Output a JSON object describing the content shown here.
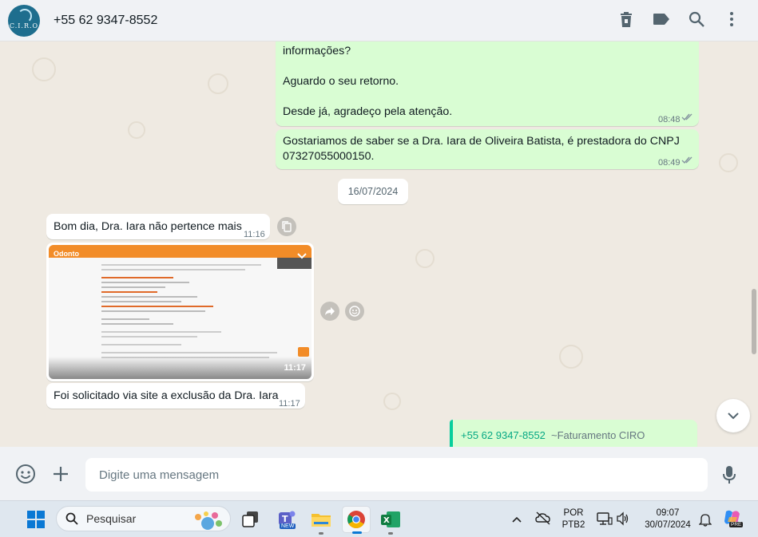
{
  "header": {
    "avatar_text": "C.I.R.O",
    "contact_name": "+55 62 9347-8552"
  },
  "messages": {
    "out1": {
      "lines": [
        "informações?",
        "Aguardo o seu retorno.",
        "Desde já, agradeço pela atenção."
      ],
      "time": "08:48"
    },
    "out2": {
      "text_line1": "Gostariamos de saber se a Dra. Iara de Oliveira Batista, é prestadora do CNPJ",
      "text_line2": "07327055000150.",
      "time": "08:49"
    },
    "date_separator": "16/07/2024",
    "in1": {
      "text": "Bom dia, Dra. Iara não pertence mais",
      "time": "11:16"
    },
    "in_image": {
      "time": "11:17",
      "logo": "Odonto"
    },
    "in2": {
      "text": "Foi solicitado via site a exclusão da Dra. Iara",
      "time": "11:17"
    },
    "quoted": {
      "sender": "+55 62 9347-8552",
      "sender_name": "~Faturamento CIRO"
    }
  },
  "composer": {
    "placeholder": "Digite uma mensagem"
  },
  "taskbar": {
    "search_label": "Pesquisar",
    "lang_top": "POR",
    "lang_bottom": "PTB2",
    "clock_time": "09:07",
    "clock_date": "30/07/2024",
    "teams_badge": "NEW",
    "copilot_badge": "PRE"
  },
  "colors": {
    "outgoing_bubble": "#d9fdd3",
    "incoming_bubble": "#ffffff",
    "chat_background": "#efeae2",
    "read_ticks": "#53bdeb",
    "quote_accent": "#06cf9c"
  },
  "icons": [
    "delete-icon",
    "label-icon",
    "search-icon",
    "menu-icon",
    "emoji-icon",
    "plus-icon",
    "mic-icon",
    "forward-icon",
    "react-icon",
    "copy-icon",
    "chevron-down-icon"
  ]
}
